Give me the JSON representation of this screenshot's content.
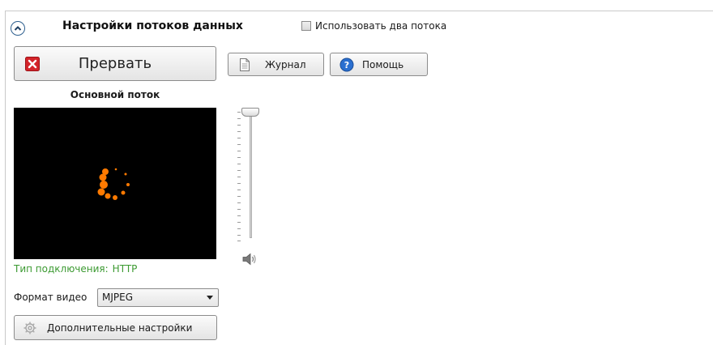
{
  "header": {
    "title": "Настройки потоков данных",
    "two_streams_label": "Использовать два потока",
    "two_streams_checked": false
  },
  "toolbar": {
    "stop_label": "Прервать",
    "journal_label": "Журнал",
    "help_label": "Помощь"
  },
  "stream": {
    "label": "Основной поток",
    "connection_label": "Тип подключения:",
    "connection_value": "HTTP"
  },
  "format": {
    "label": "Формат видео",
    "selected": "MJPEG"
  },
  "advanced": {
    "label": "Дополнительные настройки"
  },
  "volume": {
    "level": 1.0
  },
  "colors": {
    "accent": "#2d5f8e",
    "stop_red": "#d3242a",
    "connection_green": "#3c9a32",
    "spinner_orange": "#ff7a00",
    "help_blue": "#2a6fd0"
  },
  "icons": {
    "collapse": "chevron-up-circle-icon",
    "stop": "red-x-icon",
    "journal": "document-icon",
    "help": "question-icon",
    "loading": "loading-spinner-icon",
    "advanced": "gear-icon",
    "volume": "speaker-icon"
  }
}
